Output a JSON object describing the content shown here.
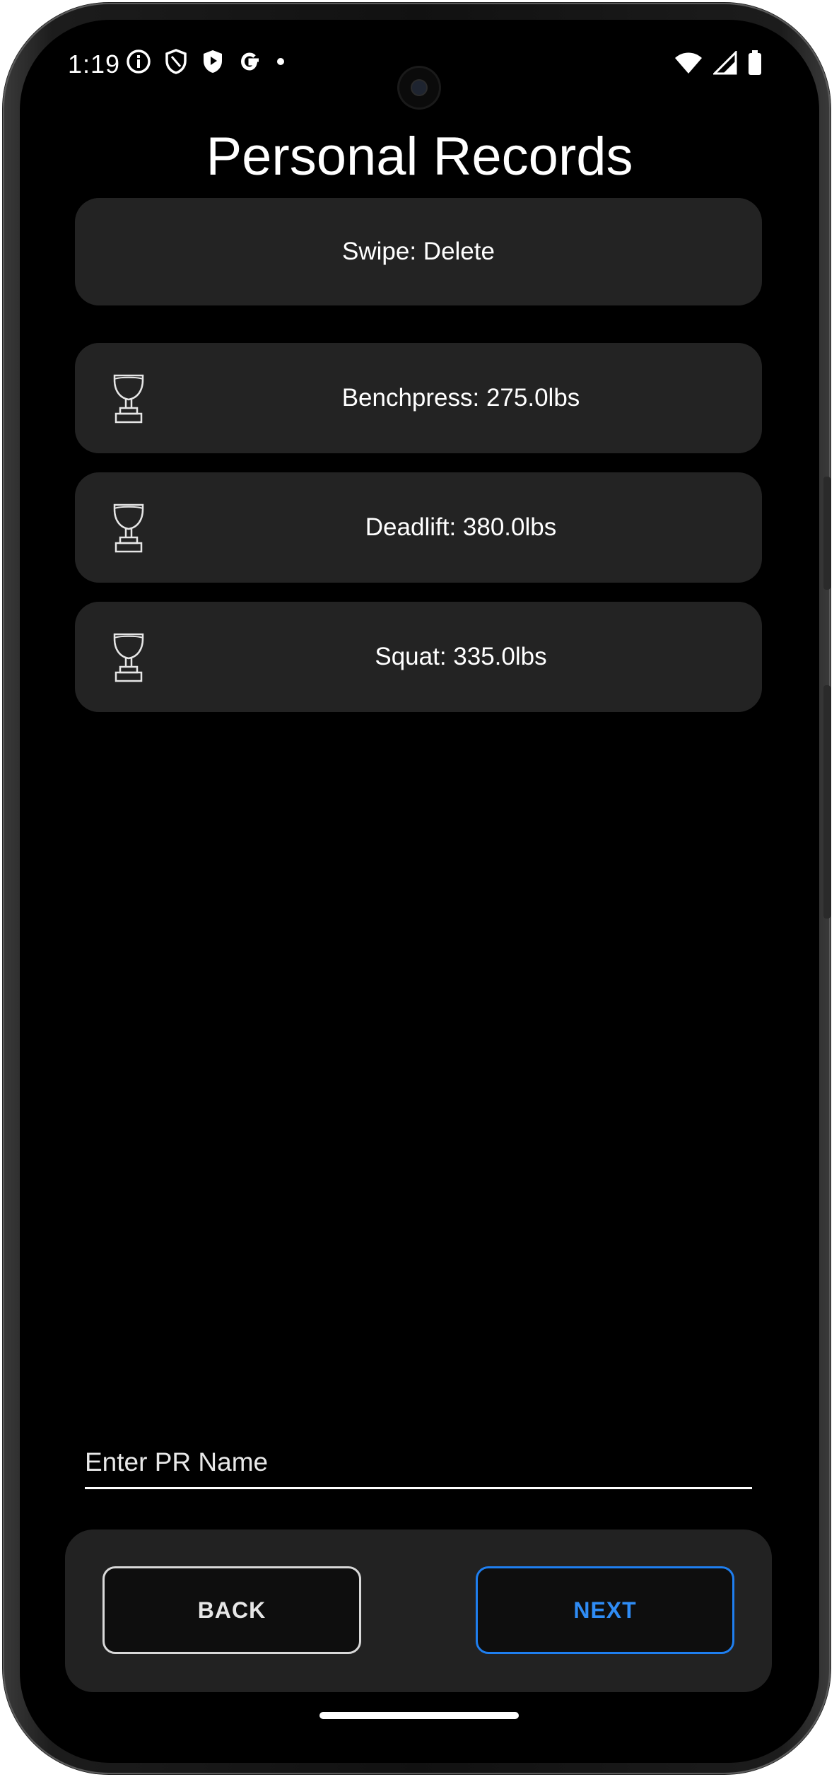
{
  "status_bar": {
    "time": "1:19",
    "left_icons": [
      "info-icon",
      "shield-outline-icon",
      "shield-play-icon",
      "google-icon",
      "dot-icon"
    ],
    "right_icons": [
      "wifi-icon",
      "signal-icon",
      "battery-icon"
    ]
  },
  "page": {
    "title": "Personal Records"
  },
  "hint": {
    "label": "Swipe: Delete"
  },
  "records": [
    {
      "icon": "trophy-icon",
      "label": "Benchpress: 275.0lbs"
    },
    {
      "icon": "trophy-icon",
      "label": "Deadlift: 380.0lbs"
    },
    {
      "icon": "trophy-icon",
      "label": "Squat: 335.0lbs"
    }
  ],
  "pr_input": {
    "placeholder": "Enter PR Name",
    "value": ""
  },
  "buttons": {
    "back_label": "BACK",
    "next_label": "NEXT"
  },
  "colors": {
    "background": "#000000",
    "card": "#232323",
    "accent": "#2f8cf5",
    "text": "#ffffff"
  }
}
